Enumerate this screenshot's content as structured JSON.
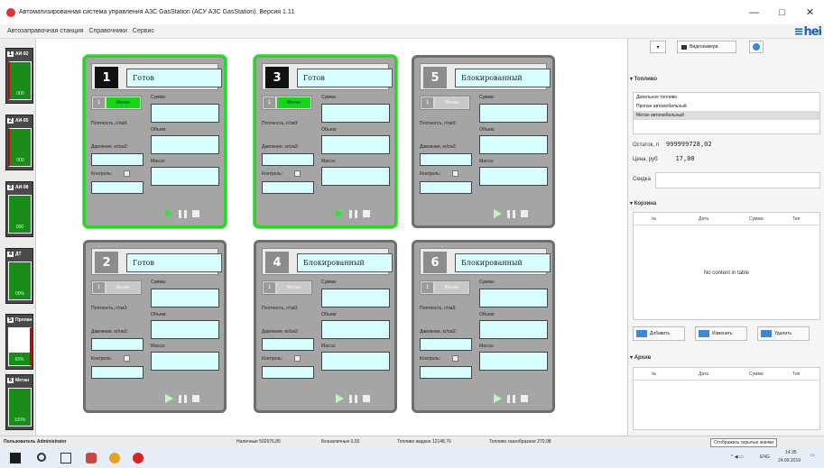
{
  "window": {
    "title": "Автоматизированная система управления АЗС GasStation (АСУ АЗС GasStation). Версия 1.11",
    "minimize": "—",
    "maximize": "□",
    "close": "✕"
  },
  "menu": {
    "items": [
      "Автозаправочная станция",
      "Справочники",
      "Сервис"
    ],
    "logo": "hei"
  },
  "left_strip": [
    {
      "num": "1",
      "name": "АИ-92",
      "value": "000",
      "style": "green"
    },
    {
      "num": "2",
      "name": "АИ-95",
      "value": "000",
      "style": "green"
    },
    {
      "num": "3",
      "name": "АИ-98",
      "value": "000",
      "style": "green"
    },
    {
      "num": "4",
      "name": "ДТ",
      "value": "00%",
      "style": "green"
    },
    {
      "num": "5",
      "name": "Пропан",
      "value": "65%",
      "style": "white"
    },
    {
      "num": "6",
      "name": "Метан",
      "value": "100%",
      "style": "green"
    }
  ],
  "dispensers": [
    {
      "num": "1",
      "state": "Готов",
      "fuel_idx": "1",
      "fuel": "Метан",
      "active": true
    },
    {
      "num": "3",
      "state": "Готов",
      "fuel_idx": "1",
      "fuel": "Метан",
      "active": true
    },
    {
      "num": "5",
      "state": "Блокированный",
      "fuel_idx": "1",
      "fuel": "Метан",
      "active": false
    },
    {
      "num": "2",
      "state": "Готов",
      "fuel_idx": "1",
      "fuel": "Метан",
      "active": false
    },
    {
      "num": "4",
      "state": "Блокированный",
      "fuel_idx": "1",
      "fuel": "Метан",
      "active": false
    },
    {
      "num": "6",
      "state": "Блокированный",
      "fuel_idx": "1",
      "fuel": "Метан",
      "active": false
    }
  ],
  "dispenser_labels": {
    "sum": "Сумма:",
    "density": "Плотность, г/см3:",
    "volume": "Объем:",
    "pressure": "Давление, кг/см2:",
    "mass": "Масса:",
    "control": "Контроль:"
  },
  "right": {
    "camera_label": "Видеокамера",
    "fuel_section": "Топливо",
    "fuel_list": [
      "Дизельное топливо",
      "Пропан автомобильный",
      "Метан автомобильный"
    ],
    "remaining_label": "Остаток, л",
    "remaining_value": "999999728,02",
    "price_label": "Цена, руб",
    "price_value": "17,00",
    "discount_label": "Скидка",
    "cart_section": "Корзина",
    "cart_columns": [
      "№",
      "Дата",
      "Сумма",
      "Тип"
    ],
    "empty_text": "No content in table",
    "btn_add": "Добавить",
    "btn_edit": "Изменить",
    "btn_delete": "Удалить",
    "archive_section": "Архив",
    "archive_columns": [
      "№",
      "Дата",
      "Сумма",
      "Тип"
    ]
  },
  "status": {
    "user": "Пользователь Administrator",
    "cash": "Наличные 502976,85",
    "noncash": "Безналичные 0,00",
    "liquid": "Топливо жидкое 12148,76",
    "gas": "Топливо газообразное 270,98",
    "tooltip": "Отображать скрытые значки"
  },
  "taskbar": {
    "lang": "ENG",
    "time": "14:35",
    "date": "24.09.2019"
  }
}
